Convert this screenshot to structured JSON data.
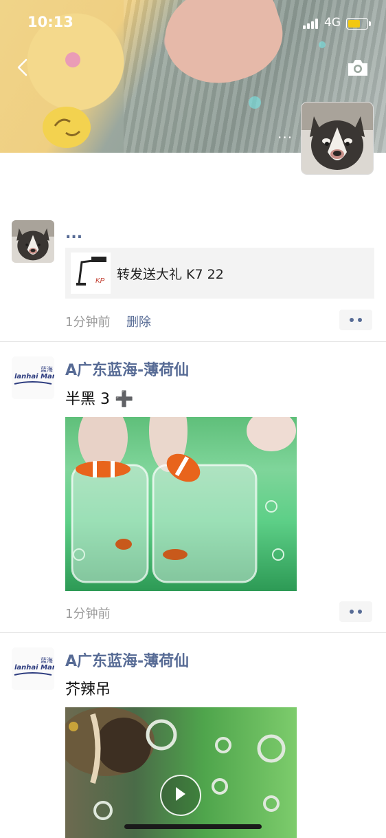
{
  "status_bar": {
    "time": "10:13",
    "network": "4G"
  },
  "header": {
    "more_label": "···"
  },
  "posts": [
    {
      "author": "...",
      "share": {
        "title": "转发送大礼 K7 22"
      },
      "time": "1分钟前",
      "delete_label": "删除"
    },
    {
      "author": "A广东蓝海-薄荷仙",
      "text": "半黑 3 ➕",
      "time": "1分钟前",
      "logo_text": "lanhai Marine",
      "logo_cn": "蓝海"
    },
    {
      "author": "A广东蓝海-薄荷仙",
      "text": "芥辣吊",
      "logo_text": "lanhai Marine",
      "logo_cn": "蓝海"
    }
  ],
  "share_thumb_text": "KP",
  "colors": {
    "link": "#576b95",
    "meta": "#9a9a9a",
    "battery": "#f2c811"
  },
  "icons": [
    "back-icon",
    "camera-icon",
    "signal-icon",
    "battery-icon",
    "more-dots-icon",
    "play-icon"
  ]
}
